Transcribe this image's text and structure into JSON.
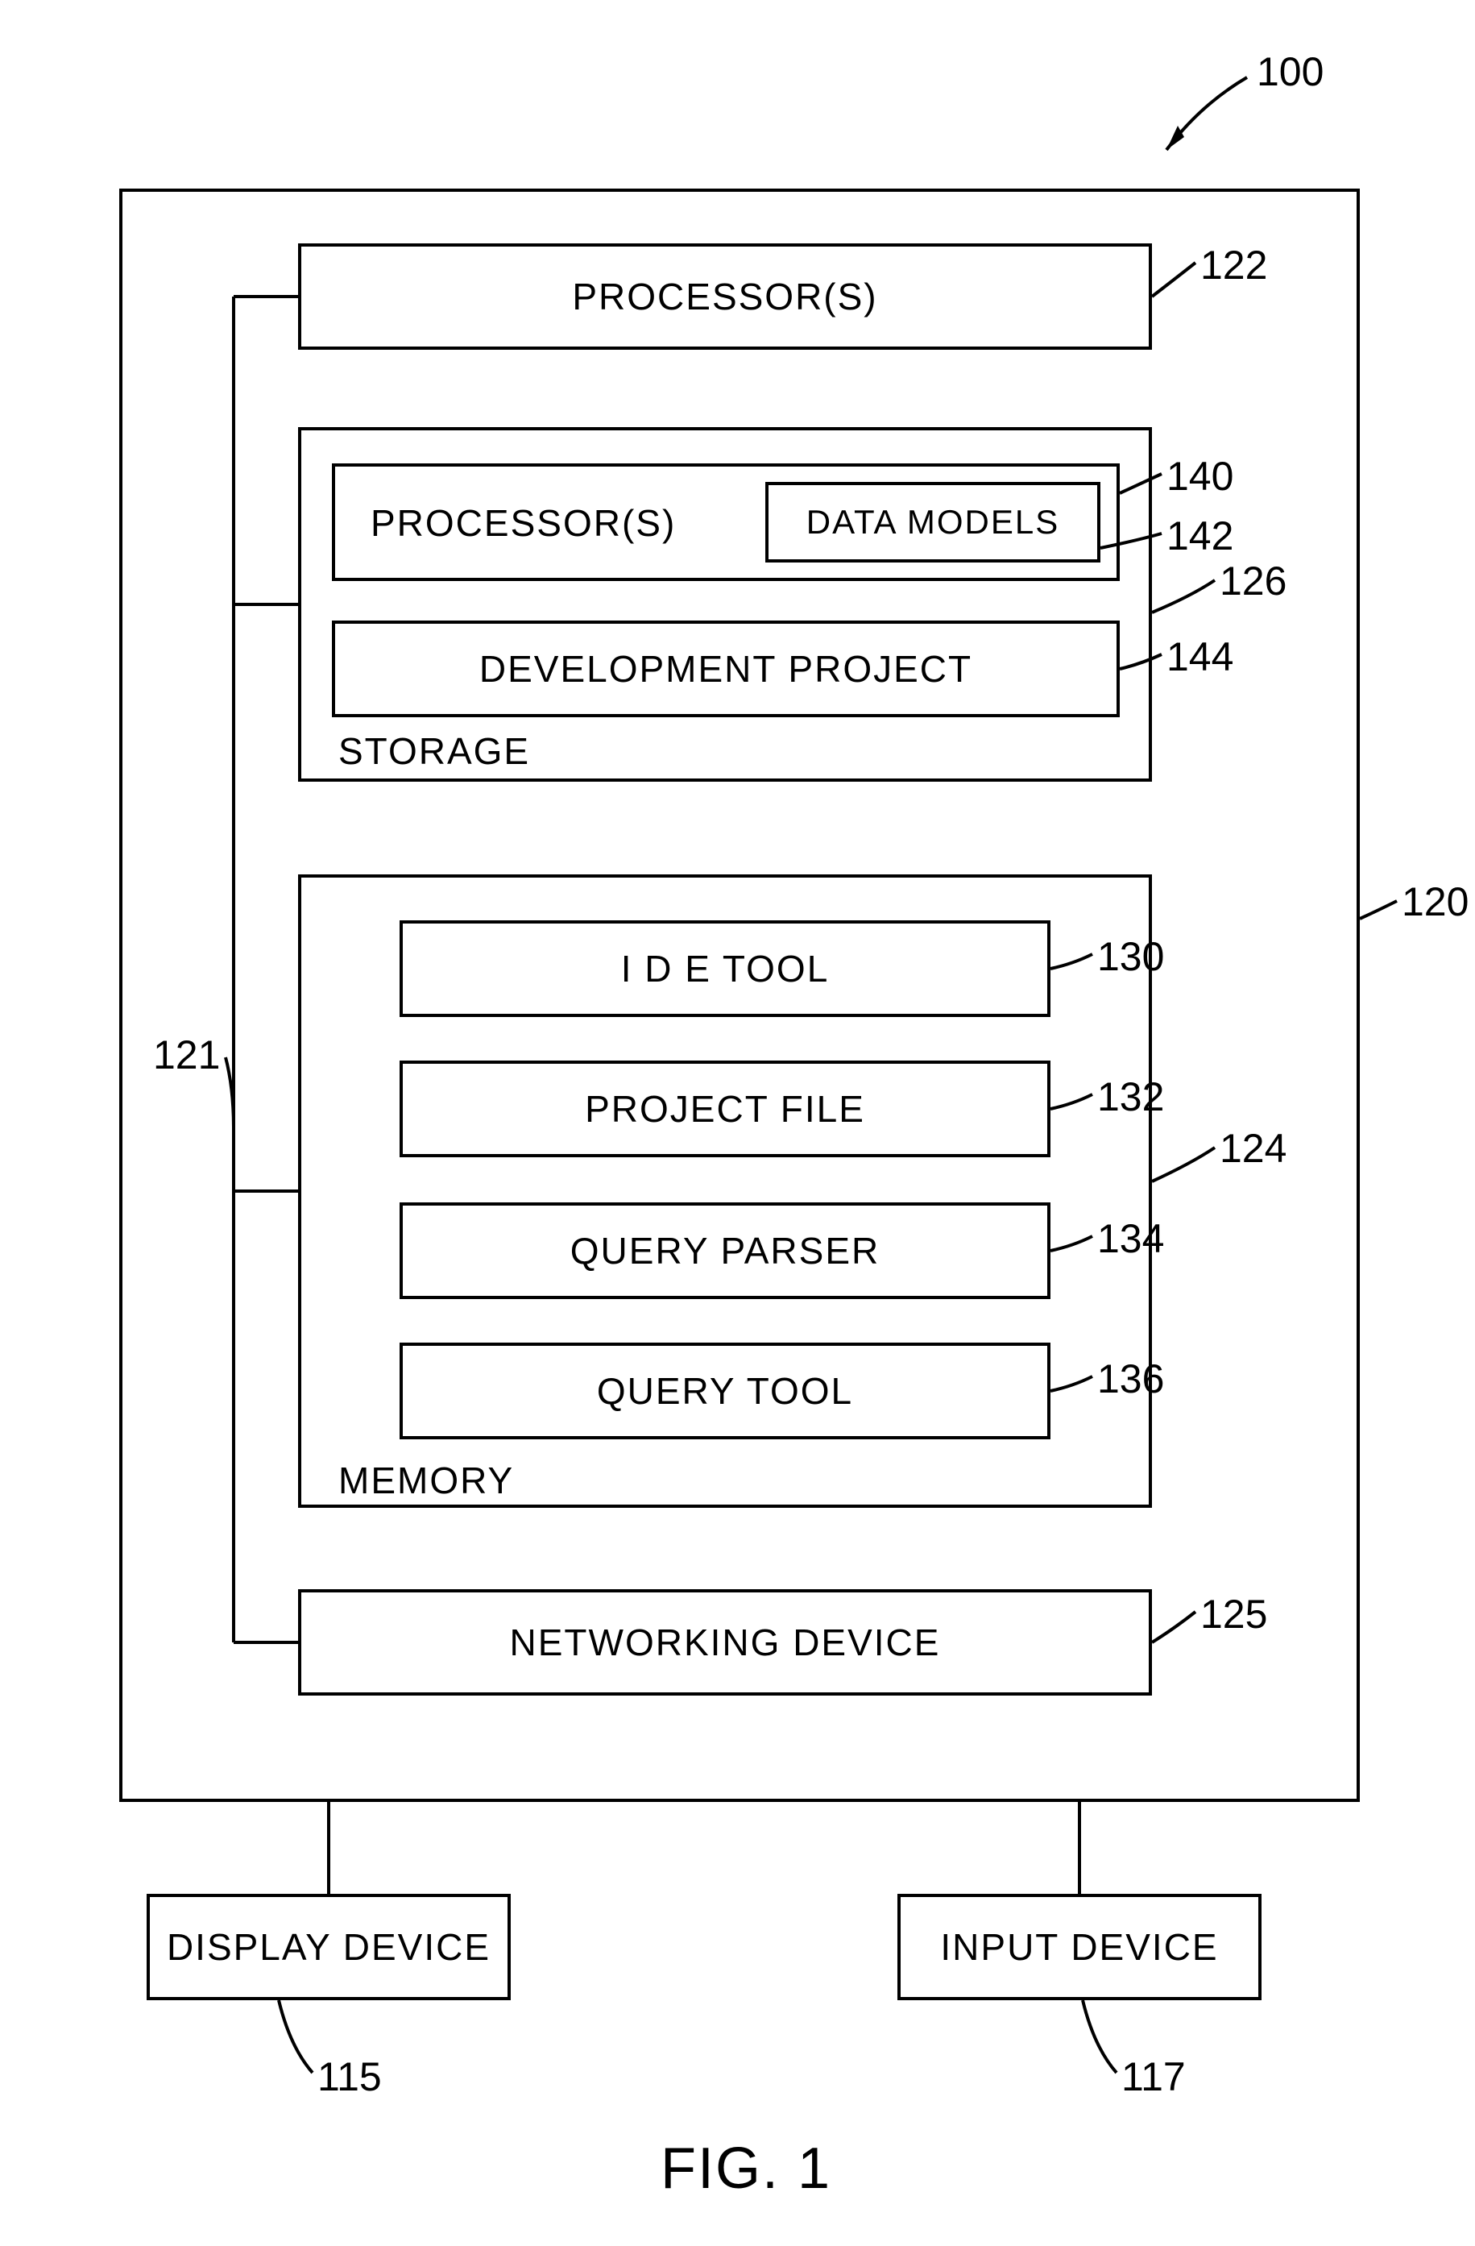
{
  "figure_caption": "FIG. 1",
  "refs": {
    "r100": "100",
    "r120": "120",
    "r121": "121",
    "r122": "122",
    "r124": "124",
    "r125": "125",
    "r126": "126",
    "r130": "130",
    "r132": "132",
    "r134": "134",
    "r136": "136",
    "r140": "140",
    "r142": "142",
    "r144": "144",
    "r115": "115",
    "r117": "117"
  },
  "boxes": {
    "processor_top": "PROCESSOR(S)",
    "storage_label": "STORAGE",
    "storage_proc": "PROCESSOR(S)",
    "data_models": "DATA  MODELS",
    "dev_project": "DEVELOPMENT PROJECT",
    "memory_label": "MEMORY",
    "ide_tool": "I D E   TOOL",
    "project_file": "PROJECT FILE",
    "query_parser": "QUERY PARSER",
    "query_tool": "QUERY TOOL",
    "networking": "NETWORKING DEVICE",
    "display": "DISPLAY DEVICE",
    "input": "INPUT DEVICE"
  }
}
